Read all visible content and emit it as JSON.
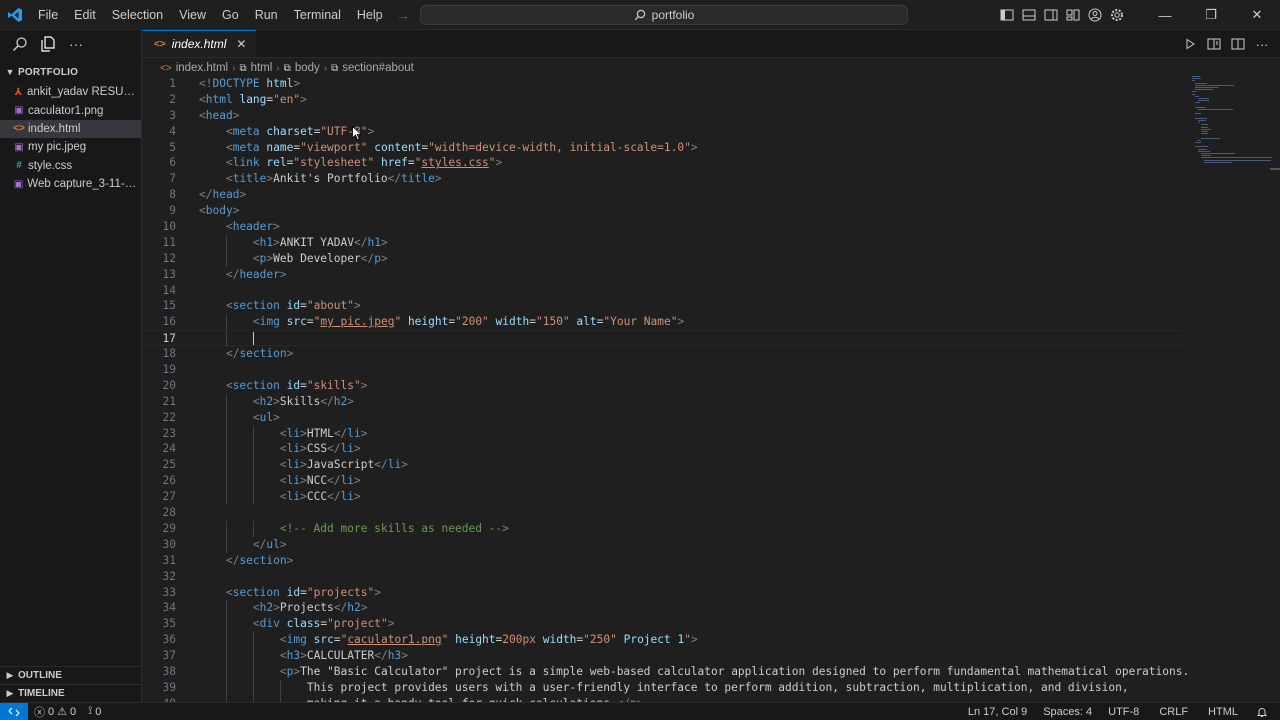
{
  "titlebar": {
    "menu": [
      "File",
      "Edit",
      "Selection",
      "View",
      "Go",
      "Run",
      "Terminal",
      "Help"
    ],
    "search_text": "portfolio"
  },
  "sidebar": {
    "section_title": "PORTFOLIO",
    "files": [
      {
        "name": "ankit_yadav RESUME...",
        "icon": "pdf-icon",
        "color": "#e44d26",
        "glyph": "⅄"
      },
      {
        "name": "caculator1.png",
        "icon": "image-icon",
        "color": "#a074c4",
        "glyph": "▣"
      },
      {
        "name": "index.html",
        "icon": "html-icon",
        "color": "#e37933",
        "glyph": "<>",
        "active": true
      },
      {
        "name": "my pic.jpeg",
        "icon": "image-icon",
        "color": "#a074c4",
        "glyph": "▣"
      },
      {
        "name": "style.css",
        "icon": "css-icon",
        "color": "#519aba",
        "glyph": "#"
      },
      {
        "name": "Web capture_3-11-20...",
        "icon": "image-icon",
        "color": "#a074c4",
        "glyph": "▣"
      }
    ],
    "outline": "OUTLINE",
    "timeline": "TIMELINE"
  },
  "editor": {
    "tab_label": "index.html",
    "breadcrumb": [
      "index.html",
      "html",
      "body",
      "section#about"
    ],
    "current_line": 17,
    "lines": [
      {
        "n": 1,
        "i": 0,
        "s": [
          [
            "br",
            "<!"
          ],
          [
            "tag",
            "DOCTYPE"
          ],
          [
            "txt",
            " "
          ],
          [
            "attr",
            "html"
          ],
          [
            "br",
            ">"
          ]
        ]
      },
      {
        "n": 2,
        "i": 0,
        "s": [
          [
            "br",
            "<"
          ],
          [
            "tag",
            "html"
          ],
          [
            "txt",
            " "
          ],
          [
            "attr",
            "lang"
          ],
          [
            "txt",
            "="
          ],
          [
            "str",
            "\"en\""
          ],
          [
            "br",
            ">"
          ]
        ]
      },
      {
        "n": 3,
        "i": 0,
        "s": [
          [
            "br",
            "<"
          ],
          [
            "tag",
            "head"
          ],
          [
            "br",
            ">"
          ]
        ]
      },
      {
        "n": 4,
        "i": 1,
        "s": [
          [
            "br",
            "<"
          ],
          [
            "tag",
            "meta"
          ],
          [
            "txt",
            " "
          ],
          [
            "attr",
            "charset"
          ],
          [
            "txt",
            "="
          ],
          [
            "str",
            "\"UTF-8\""
          ],
          [
            "br",
            ">"
          ]
        ]
      },
      {
        "n": 5,
        "i": 1,
        "s": [
          [
            "br",
            "<"
          ],
          [
            "tag",
            "meta"
          ],
          [
            "txt",
            " "
          ],
          [
            "attr",
            "name"
          ],
          [
            "txt",
            "="
          ],
          [
            "str",
            "\"viewport\""
          ],
          [
            "txt",
            " "
          ],
          [
            "attr",
            "content"
          ],
          [
            "txt",
            "="
          ],
          [
            "str",
            "\"width=device-width, initial-scale=1.0\""
          ],
          [
            "br",
            ">"
          ]
        ]
      },
      {
        "n": 6,
        "i": 1,
        "s": [
          [
            "br",
            "<"
          ],
          [
            "tag",
            "link"
          ],
          [
            "txt",
            " "
          ],
          [
            "attr",
            "rel"
          ],
          [
            "txt",
            "="
          ],
          [
            "str",
            "\"stylesheet\""
          ],
          [
            "txt",
            " "
          ],
          [
            "attr",
            "href"
          ],
          [
            "txt",
            "="
          ],
          [
            "str",
            "\""
          ],
          [
            "link",
            "styles.css"
          ],
          [
            "str",
            "\""
          ],
          [
            "br",
            ">"
          ]
        ]
      },
      {
        "n": 7,
        "i": 1,
        "s": [
          [
            "br",
            "<"
          ],
          [
            "tag",
            "title"
          ],
          [
            "br",
            ">"
          ],
          [
            "txt",
            "Ankit's Portfolio"
          ],
          [
            "br",
            "</"
          ],
          [
            "tag",
            "title"
          ],
          [
            "br",
            ">"
          ]
        ]
      },
      {
        "n": 8,
        "i": 0,
        "s": [
          [
            "br",
            "</"
          ],
          [
            "tag",
            "head"
          ],
          [
            "br",
            ">"
          ]
        ]
      },
      {
        "n": 9,
        "i": 0,
        "s": [
          [
            "br",
            "<"
          ],
          [
            "tag",
            "body"
          ],
          [
            "br",
            ">"
          ]
        ]
      },
      {
        "n": 10,
        "i": 1,
        "s": [
          [
            "br",
            "<"
          ],
          [
            "tag",
            "header"
          ],
          [
            "br",
            ">"
          ]
        ]
      },
      {
        "n": 11,
        "i": 2,
        "s": [
          [
            "br",
            "<"
          ],
          [
            "tag",
            "h1"
          ],
          [
            "br",
            ">"
          ],
          [
            "txt",
            "ANKIT YADAV"
          ],
          [
            "br",
            "</"
          ],
          [
            "tag",
            "h1"
          ],
          [
            "br",
            ">"
          ]
        ]
      },
      {
        "n": 12,
        "i": 2,
        "s": [
          [
            "br",
            "<"
          ],
          [
            "tag",
            "p"
          ],
          [
            "br",
            ">"
          ],
          [
            "txt",
            "Web Developer"
          ],
          [
            "br",
            "</"
          ],
          [
            "tag",
            "p"
          ],
          [
            "br",
            ">"
          ]
        ]
      },
      {
        "n": 13,
        "i": 1,
        "s": [
          [
            "br",
            "</"
          ],
          [
            "tag",
            "header"
          ],
          [
            "br",
            ">"
          ]
        ]
      },
      {
        "n": 14,
        "i": 0,
        "s": []
      },
      {
        "n": 15,
        "i": 1,
        "s": [
          [
            "br",
            "<"
          ],
          [
            "tag",
            "section"
          ],
          [
            "txt",
            " "
          ],
          [
            "attr",
            "id"
          ],
          [
            "txt",
            "="
          ],
          [
            "str",
            "\"about\""
          ],
          [
            "br",
            ">"
          ]
        ]
      },
      {
        "n": 16,
        "i": 2,
        "s": [
          [
            "br",
            "<"
          ],
          [
            "tag",
            "img"
          ],
          [
            "txt",
            " "
          ],
          [
            "attr",
            "src"
          ],
          [
            "txt",
            "="
          ],
          [
            "str",
            "\""
          ],
          [
            "link",
            "my pic.jpeg"
          ],
          [
            "str",
            "\""
          ],
          [
            "txt",
            " "
          ],
          [
            "attr",
            "height"
          ],
          [
            "txt",
            "="
          ],
          [
            "str",
            "\"200\""
          ],
          [
            "txt",
            " "
          ],
          [
            "attr",
            "width"
          ],
          [
            "txt",
            "="
          ],
          [
            "str",
            "\"150\""
          ],
          [
            "txt",
            " "
          ],
          [
            "attr",
            "alt"
          ],
          [
            "txt",
            "="
          ],
          [
            "str",
            "\"Your Name\""
          ],
          [
            "br",
            ">"
          ]
        ]
      },
      {
        "n": 17,
        "i": 2,
        "s": []
      },
      {
        "n": 18,
        "i": 1,
        "s": [
          [
            "br",
            "</"
          ],
          [
            "tag",
            "section"
          ],
          [
            "br",
            ">"
          ]
        ]
      },
      {
        "n": 19,
        "i": 0,
        "s": []
      },
      {
        "n": 20,
        "i": 1,
        "s": [
          [
            "br",
            "<"
          ],
          [
            "tag",
            "section"
          ],
          [
            "txt",
            " "
          ],
          [
            "attr",
            "id"
          ],
          [
            "txt",
            "="
          ],
          [
            "str",
            "\"skills\""
          ],
          [
            "br",
            ">"
          ]
        ]
      },
      {
        "n": 21,
        "i": 2,
        "s": [
          [
            "br",
            "<"
          ],
          [
            "tag",
            "h2"
          ],
          [
            "br",
            ">"
          ],
          [
            "txt",
            "Skills"
          ],
          [
            "br",
            "</"
          ],
          [
            "tag",
            "h2"
          ],
          [
            "br",
            ">"
          ]
        ]
      },
      {
        "n": 22,
        "i": 2,
        "s": [
          [
            "br",
            "<"
          ],
          [
            "tag",
            "ul"
          ],
          [
            "br",
            ">"
          ]
        ]
      },
      {
        "n": 23,
        "i": 3,
        "s": [
          [
            "br",
            "<"
          ],
          [
            "tag",
            "li"
          ],
          [
            "br",
            ">"
          ],
          [
            "txt",
            "HTML"
          ],
          [
            "br",
            "</"
          ],
          [
            "tag",
            "li"
          ],
          [
            "br",
            ">"
          ]
        ]
      },
      {
        "n": 24,
        "i": 3,
        "s": [
          [
            "br",
            "<"
          ],
          [
            "tag",
            "li"
          ],
          [
            "br",
            ">"
          ],
          [
            "txt",
            "CSS"
          ],
          [
            "br",
            "</"
          ],
          [
            "tag",
            "li"
          ],
          [
            "br",
            ">"
          ]
        ]
      },
      {
        "n": 25,
        "i": 3,
        "s": [
          [
            "br",
            "<"
          ],
          [
            "tag",
            "li"
          ],
          [
            "br",
            ">"
          ],
          [
            "txt",
            "JavaScript"
          ],
          [
            "br",
            "</"
          ],
          [
            "tag",
            "li"
          ],
          [
            "br",
            ">"
          ]
        ]
      },
      {
        "n": 26,
        "i": 3,
        "s": [
          [
            "br",
            "<"
          ],
          [
            "tag",
            "li"
          ],
          [
            "br",
            ">"
          ],
          [
            "txt",
            "NCC"
          ],
          [
            "br",
            "</"
          ],
          [
            "tag",
            "li"
          ],
          [
            "br",
            ">"
          ]
        ]
      },
      {
        "n": 27,
        "i": 3,
        "s": [
          [
            "br",
            "<"
          ],
          [
            "tag",
            "li"
          ],
          [
            "br",
            ">"
          ],
          [
            "txt",
            "CCC"
          ],
          [
            "br",
            "</"
          ],
          [
            "tag",
            "li"
          ],
          [
            "br",
            ">"
          ]
        ]
      },
      {
        "n": 28,
        "i": 0,
        "s": []
      },
      {
        "n": 29,
        "i": 3,
        "s": [
          [
            "com",
            "<!-- Add more skills as needed -->"
          ]
        ]
      },
      {
        "n": 30,
        "i": 2,
        "s": [
          [
            "br",
            "</"
          ],
          [
            "tag",
            "ul"
          ],
          [
            "br",
            ">"
          ]
        ]
      },
      {
        "n": 31,
        "i": 1,
        "s": [
          [
            "br",
            "</"
          ],
          [
            "tag",
            "section"
          ],
          [
            "br",
            ">"
          ]
        ]
      },
      {
        "n": 32,
        "i": 0,
        "s": []
      },
      {
        "n": 33,
        "i": 1,
        "s": [
          [
            "br",
            "<"
          ],
          [
            "tag",
            "section"
          ],
          [
            "txt",
            " "
          ],
          [
            "attr",
            "id"
          ],
          [
            "txt",
            "="
          ],
          [
            "str",
            "\"projects\""
          ],
          [
            "br",
            ">"
          ]
        ]
      },
      {
        "n": 34,
        "i": 2,
        "s": [
          [
            "br",
            "<"
          ],
          [
            "tag",
            "h2"
          ],
          [
            "br",
            ">"
          ],
          [
            "txt",
            "Projects"
          ],
          [
            "br",
            "</"
          ],
          [
            "tag",
            "h2"
          ],
          [
            "br",
            ">"
          ]
        ]
      },
      {
        "n": 35,
        "i": 2,
        "s": [
          [
            "br",
            "<"
          ],
          [
            "tag",
            "div"
          ],
          [
            "txt",
            " "
          ],
          [
            "attr",
            "class"
          ],
          [
            "txt",
            "="
          ],
          [
            "str",
            "\"project\""
          ],
          [
            "br",
            ">"
          ]
        ]
      },
      {
        "n": 36,
        "i": 3,
        "s": [
          [
            "br",
            "<"
          ],
          [
            "tag",
            "img"
          ],
          [
            "txt",
            " "
          ],
          [
            "attr",
            "src"
          ],
          [
            "txt",
            "="
          ],
          [
            "str",
            "\""
          ],
          [
            "link",
            "caculator1.png"
          ],
          [
            "str",
            "\""
          ],
          [
            "txt",
            " "
          ],
          [
            "attr",
            "height"
          ],
          [
            "txt",
            "="
          ],
          [
            "str",
            "200px"
          ],
          [
            "txt",
            " "
          ],
          [
            "attr",
            "width"
          ],
          [
            "txt",
            "="
          ],
          [
            "str",
            "\"250\""
          ],
          [
            "txt",
            " "
          ],
          [
            "attr",
            "Project"
          ],
          [
            "txt",
            " "
          ],
          [
            "attr",
            "1"
          ],
          [
            "str",
            "\""
          ],
          [
            "br",
            ">"
          ]
        ]
      },
      {
        "n": 37,
        "i": 3,
        "s": [
          [
            "br",
            "<"
          ],
          [
            "tag",
            "h3"
          ],
          [
            "br",
            ">"
          ],
          [
            "txt",
            "CALCULATER"
          ],
          [
            "br",
            "</"
          ],
          [
            "tag",
            "h3"
          ],
          [
            "br",
            ">"
          ]
        ]
      },
      {
        "n": 38,
        "i": 3,
        "s": [
          [
            "br",
            "<"
          ],
          [
            "tag",
            "p"
          ],
          [
            "br",
            ">"
          ],
          [
            "txt",
            "The \"Basic Calculator\" project is a simple web-based calculator application designed to perform fundamental mathematical operations."
          ]
        ]
      },
      {
        "n": 39,
        "i": 4,
        "s": [
          [
            "txt",
            "This project provides users with a user-friendly interface to perform addition, subtraction, multiplication, and division,"
          ]
        ]
      },
      {
        "n": 40,
        "i": 4,
        "s": [
          [
            "txt",
            "making it a handy tool for quick calculations."
          ],
          [
            "br",
            "</"
          ],
          [
            "tag",
            "p"
          ],
          [
            "br",
            ">"
          ]
        ]
      }
    ]
  },
  "statusbar": {
    "errors": "0",
    "warnings": "0",
    "ports": "0",
    "position": "Ln 17, Col 9",
    "spaces": "Spaces: 4",
    "encoding": "UTF-8",
    "eol": "CRLF",
    "language": "HTML"
  }
}
